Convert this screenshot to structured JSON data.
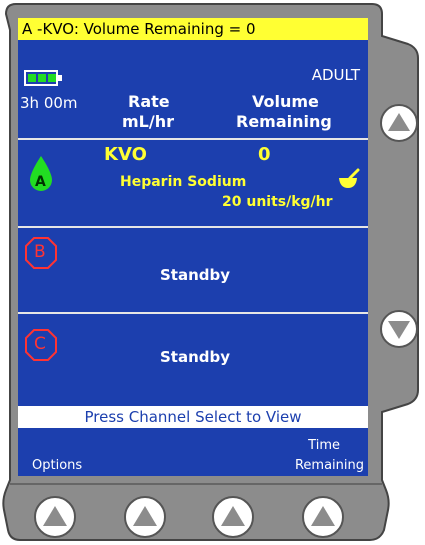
{
  "alarm": {
    "text": "A -KVO: Volume Remaining = 0"
  },
  "battery": {
    "time": "3h 00m",
    "level_fraction": 1.0
  },
  "header": {
    "patient_type": "ADULT",
    "rate_label_line1": "Rate",
    "rate_label_line2": "mL/hr",
    "volume_label_line1": "Volume",
    "volume_label_line2": "Remaining"
  },
  "channel_a": {
    "letter": "A",
    "rate": "KVO",
    "volume": "0",
    "drug": "Heparin Sodium",
    "dose": "20 units/kg/hr"
  },
  "channel_b": {
    "letter": "B",
    "status": "Standby"
  },
  "channel_c": {
    "letter": "C",
    "status": "Standby"
  },
  "prompt": {
    "text": "Press Channel Select to View"
  },
  "softkeys": {
    "left_label": "Options",
    "right_label_line1": "Time",
    "right_label_line2": "Remaining"
  },
  "colors": {
    "screen_bg": "#1c3fae",
    "alarm_bg": "#ffff33",
    "channel_a_drop": "#22dd22",
    "channel_bc_octagon": "#ff3333",
    "housing": "#8c8c8c"
  },
  "icons": {
    "battery": "battery-full-icon",
    "drop": "droplet-icon",
    "mortar": "mortar-pestle-icon",
    "octagon": "octagon-icon",
    "up": "arrow-up-icon",
    "down": "arrow-down-icon"
  }
}
